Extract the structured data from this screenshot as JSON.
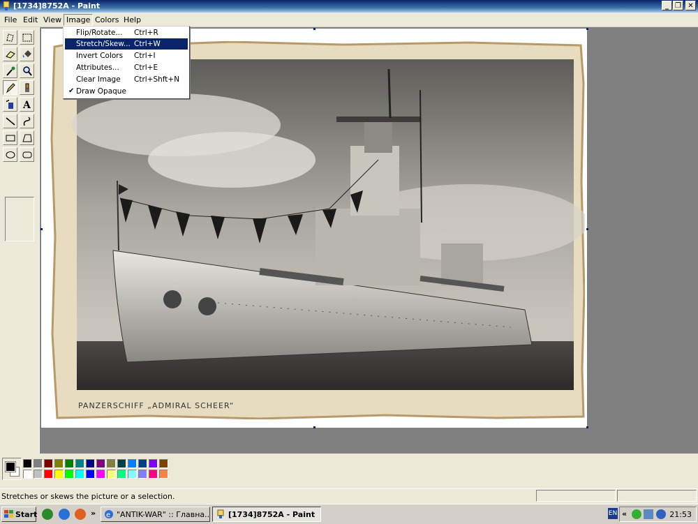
{
  "window": {
    "title": "[1734]8752A - Paint"
  },
  "menu": [
    "File",
    "Edit",
    "View",
    "Image",
    "Colors",
    "Help"
  ],
  "image_menu": {
    "items": [
      {
        "label": "Flip/Rotate...",
        "shortcut": "Ctrl+R"
      },
      {
        "label": "Stretch/Skew...",
        "shortcut": "Ctrl+W"
      },
      {
        "label": "Invert Colors",
        "shortcut": "Ctrl+I"
      },
      {
        "label": "Attributes...",
        "shortcut": "Ctrl+E"
      },
      {
        "label": "Clear Image",
        "shortcut": "Ctrl+Shft+N"
      },
      {
        "label": "Draw Opaque",
        "shortcut": ""
      }
    ],
    "highlighted": "Stretch/Skew...",
    "checked": "Draw Opaque"
  },
  "canvas": {
    "caption": "PANZERSCHIFF „ADMIRAL SCHEER“"
  },
  "tools": [
    "free-form-select",
    "select",
    "eraser",
    "fill-with-color",
    "pick-color",
    "magnifier",
    "pencil",
    "brush",
    "airbrush",
    "text",
    "line",
    "curve",
    "rectangle",
    "polygon",
    "ellipse",
    "rounded-rectangle"
  ],
  "selected_tool": "pencil",
  "palette": {
    "foreground": "#000000",
    "background": "#ffffff",
    "top_row": [
      "#000000",
      "#808080",
      "#800000",
      "#808000",
      "#008000",
      "#008080",
      "#000080",
      "#800080",
      "#808040",
      "#004040",
      "#0080ff",
      "#004080",
      "#8000ff",
      "#804000"
    ],
    "bottom_row": [
      "#ffffff",
      "#c0c0c0",
      "#ff0000",
      "#ffff00",
      "#00ff00",
      "#00ffff",
      "#0000ff",
      "#ff00ff",
      "#ffff80",
      "#00ff80",
      "#80ffff",
      "#8080ff",
      "#ff0080",
      "#ff8040"
    ]
  },
  "status": {
    "text": "Stretches or skews the picture or a selection."
  },
  "taskbar": {
    "start_label": "Start",
    "chevron": "»",
    "buttons": [
      {
        "label": "\"ANTIK-WAR\" :: Главна..."
      },
      {
        "label": "[1734]8752A - Paint"
      }
    ],
    "tray_chevron": "«",
    "language": "EN",
    "clock": "21:53"
  }
}
